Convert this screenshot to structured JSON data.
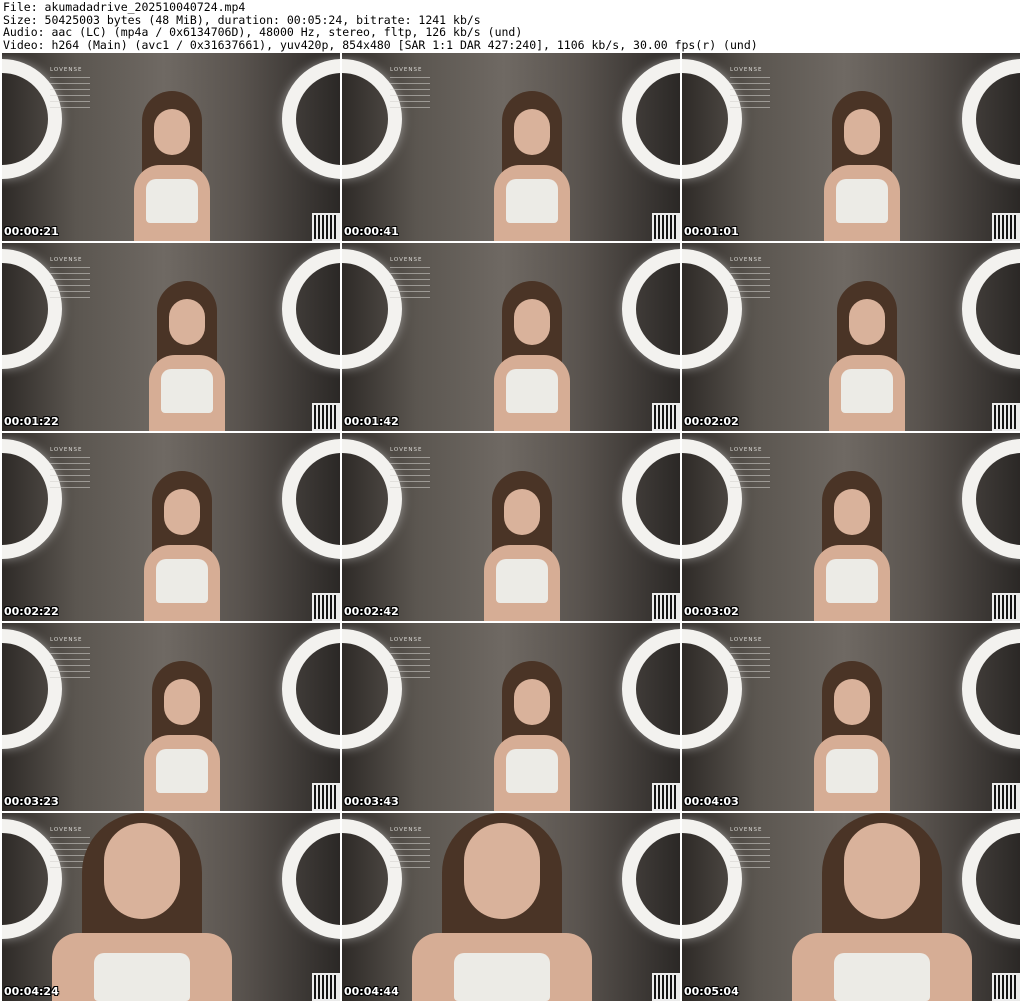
{
  "header": {
    "line1": "File: akumadadrive_202510040724.mp4",
    "line2": "Size: 50425003 bytes (48 MiB), duration: 00:05:24, bitrate: 1241 kb/s",
    "line3": "Audio: aac (LC) (mp4a / 0x6134706D), 48000 Hz, stereo, fltp, 126 kb/s (und)",
    "line4": "Video: h264 (Main) (avc1 / 0x31637661), yuv420p, 854x480 [SAR 1:1 DAR 427:240], 1106 kb/s, 30.00 fps(r) (und)"
  },
  "overlay_brand": "LOVENSE",
  "thumbnails": [
    {
      "time": "00:00:21"
    },
    {
      "time": "00:00:41"
    },
    {
      "time": "00:01:01"
    },
    {
      "time": "00:01:22"
    },
    {
      "time": "00:01:42"
    },
    {
      "time": "00:02:02"
    },
    {
      "time": "00:02:22"
    },
    {
      "time": "00:02:42"
    },
    {
      "time": "00:03:02"
    },
    {
      "time": "00:03:23"
    },
    {
      "time": "00:03:43"
    },
    {
      "time": "00:04:03"
    },
    {
      "time": "00:04:24"
    },
    {
      "time": "00:04:44"
    },
    {
      "time": "00:05:04"
    }
  ]
}
